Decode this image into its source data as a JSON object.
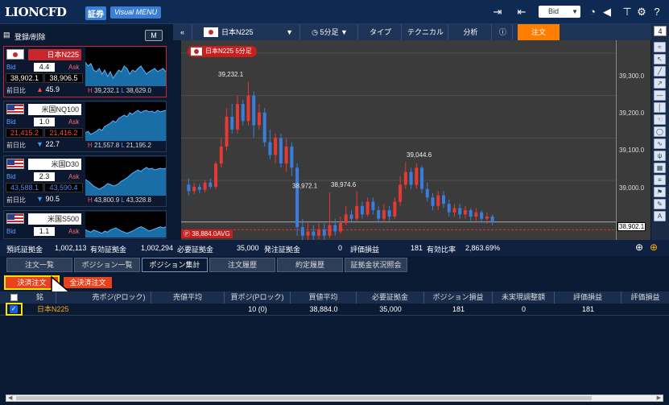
{
  "brand": {
    "logo": "LIONCFD",
    "badge": "証券",
    "menu_label": "Visual MENU"
  },
  "topbar": {
    "price_mode": "Bid"
  },
  "left": {
    "register_label": "登録/削除",
    "m_label": "M",
    "cards": [
      {
        "name": "日本N225",
        "flag": "jp",
        "spread": "4.4",
        "bid": "38,902.1",
        "ask": "38,906.5",
        "prev_label": "前日比",
        "dir": "up",
        "change": "45.9",
        "high": "39,232.1",
        "low": "38,629.0",
        "bid_color": "#ffffff",
        "ask_color": "#ffffff"
      },
      {
        "name": "米国NQ100",
        "flag": "us",
        "spread": "1.0",
        "bid": "21,415.2",
        "ask": "21,416.2",
        "prev_label": "前日比",
        "dir": "down",
        "change": "22.7",
        "high": "21,557.8",
        "low": "21,195.2",
        "bid_color": "#ff4545",
        "ask_color": "#ff4545"
      },
      {
        "name": "米国D30",
        "flag": "us",
        "spread": "2.3",
        "bid": "43,588.1",
        "ask": "43,590.4",
        "prev_label": "前日比",
        "dir": "down",
        "change": "90.5",
        "high": "43,800.9",
        "low": "43,328.8",
        "bid_color": "#4d8fff",
        "ask_color": "#4d8fff"
      },
      {
        "name": "米国S500",
        "flag": "us",
        "spread": "1.1"
      }
    ],
    "bid_label": "Bid",
    "ask_label": "Ask"
  },
  "toolbar": {
    "symbol": "日本N225",
    "interval": "5分足",
    "type": "タイプ",
    "technical": "テクニカル",
    "analysis": "分析",
    "order": "注文",
    "page": "4"
  },
  "chart": {
    "legend": "日本N225 5分足",
    "y_ticks": [
      "39,300.0",
      "39,200.0",
      "39,100.0",
      "39,000.0"
    ],
    "current_price": "38,902.1",
    "avg_label": "38,884.0AVG",
    "annotations": [
      "39,232.1",
      "38,972.1",
      "38,974.6",
      "39,044.6"
    ]
  },
  "chart_data": {
    "type": "candlestick",
    "title": "日本N225 5分足",
    "ylim": [
      38860,
      39330
    ],
    "labels": {
      "high": 39232.1,
      "peak2": 39044.6,
      "local1": 38972.1,
      "local2": 38974.6,
      "avg": 38884.0,
      "last": 38902.1
    },
    "series": [
      {
        "o": 38990,
        "c": 38975,
        "h": 39005,
        "l": 38965
      },
      {
        "o": 38975,
        "c": 38985,
        "h": 38995,
        "l": 38968
      },
      {
        "o": 38985,
        "c": 38978,
        "h": 38992,
        "l": 38970
      },
      {
        "o": 38978,
        "c": 38995,
        "h": 39000,
        "l": 38972
      },
      {
        "o": 38995,
        "c": 38985,
        "h": 39005,
        "l": 38980
      },
      {
        "o": 38985,
        "c": 39040,
        "h": 39045,
        "l": 38980
      },
      {
        "o": 39040,
        "c": 39080,
        "h": 39100,
        "l": 39030
      },
      {
        "o": 39080,
        "c": 39150,
        "h": 39170,
        "l": 39070
      },
      {
        "o": 39150,
        "c": 39120,
        "h": 39180,
        "l": 39110
      },
      {
        "o": 39120,
        "c": 39180,
        "h": 39200,
        "l": 39110
      },
      {
        "o": 39180,
        "c": 39140,
        "h": 39190,
        "l": 39130
      },
      {
        "o": 39140,
        "c": 39200,
        "h": 39232,
        "l": 39130
      },
      {
        "o": 39200,
        "c": 39130,
        "h": 39210,
        "l": 39100
      },
      {
        "o": 39130,
        "c": 39160,
        "h": 39180,
        "l": 39120
      },
      {
        "o": 39160,
        "c": 39090,
        "h": 39170,
        "l": 39080
      },
      {
        "o": 39090,
        "c": 39060,
        "h": 39120,
        "l": 39050
      },
      {
        "o": 39060,
        "c": 39100,
        "h": 39110,
        "l": 39040
      },
      {
        "o": 39100,
        "c": 39040,
        "h": 39110,
        "l": 39030
      },
      {
        "o": 39040,
        "c": 39080,
        "h": 39100,
        "l": 39020
      },
      {
        "o": 39080,
        "c": 39030,
        "h": 39090,
        "l": 39010
      },
      {
        "o": 39030,
        "c": 38890,
        "h": 39040,
        "l": 38870
      },
      {
        "o": 38890,
        "c": 38870,
        "h": 38910,
        "l": 38860
      },
      {
        "o": 38870,
        "c": 38880,
        "h": 38900,
        "l": 38860
      },
      {
        "o": 38880,
        "c": 38870,
        "h": 38895,
        "l": 38860
      },
      {
        "o": 38870,
        "c": 38885,
        "h": 38900,
        "l": 38862
      },
      {
        "o": 38885,
        "c": 38870,
        "h": 38900,
        "l": 38860
      },
      {
        "o": 38870,
        "c": 38895,
        "h": 38972,
        "l": 38865
      },
      {
        "o": 38895,
        "c": 38880,
        "h": 38910,
        "l": 38870
      },
      {
        "o": 38880,
        "c": 38900,
        "h": 38915,
        "l": 38875
      },
      {
        "o": 38900,
        "c": 38920,
        "h": 38940,
        "l": 38895
      },
      {
        "o": 38920,
        "c": 38910,
        "h": 38930,
        "l": 38900
      },
      {
        "o": 38910,
        "c": 38940,
        "h": 38975,
        "l": 38905
      },
      {
        "o": 38940,
        "c": 38920,
        "h": 38950,
        "l": 38910
      },
      {
        "o": 38920,
        "c": 38950,
        "h": 38960,
        "l": 38915
      },
      {
        "o": 38950,
        "c": 38930,
        "h": 38960,
        "l": 38920
      },
      {
        "o": 38930,
        "c": 38910,
        "h": 38940,
        "l": 38900
      },
      {
        "o": 38910,
        "c": 38930,
        "h": 38945,
        "l": 38900
      },
      {
        "o": 38930,
        "c": 38915,
        "h": 38940,
        "l": 38905
      },
      {
        "o": 38915,
        "c": 38950,
        "h": 38960,
        "l": 38910
      },
      {
        "o": 38950,
        "c": 38990,
        "h": 39010,
        "l": 38940
      },
      {
        "o": 38990,
        "c": 39020,
        "h": 39044,
        "l": 38980
      },
      {
        "o": 39020,
        "c": 38990,
        "h": 39030,
        "l": 38980
      },
      {
        "o": 38990,
        "c": 39030,
        "h": 39040,
        "l": 38980
      },
      {
        "o": 39030,
        "c": 38980,
        "h": 39035,
        "l": 38970
      },
      {
        "o": 38980,
        "c": 38960,
        "h": 38995,
        "l": 38950
      },
      {
        "o": 38960,
        "c": 38940,
        "h": 38970,
        "l": 38930
      },
      {
        "o": 38940,
        "c": 38965,
        "h": 38975,
        "l": 38930
      },
      {
        "o": 38965,
        "c": 38945,
        "h": 38975,
        "l": 38935
      },
      {
        "o": 38945,
        "c": 38925,
        "h": 38955,
        "l": 38915
      },
      {
        "o": 38925,
        "c": 38935,
        "h": 38945,
        "l": 38915
      },
      {
        "o": 38935,
        "c": 38920,
        "h": 38945,
        "l": 38910
      },
      {
        "o": 38920,
        "c": 38930,
        "h": 38940,
        "l": 38910
      },
      {
        "o": 38930,
        "c": 38915,
        "h": 38935,
        "l": 38905
      },
      {
        "o": 38915,
        "c": 38925,
        "h": 38935,
        "l": 38905
      },
      {
        "o": 38925,
        "c": 38910,
        "h": 38930,
        "l": 38900
      },
      {
        "o": 38910,
        "c": 38915,
        "h": 38925,
        "l": 38898
      },
      {
        "o": 38915,
        "c": 38902,
        "h": 38920,
        "l": 38895
      }
    ]
  },
  "status": {
    "deposit_label": "預託証拠金",
    "deposit": "1,002,113",
    "valid_label": "有効証拠金",
    "valid": "1,002,294",
    "required_label": "必要証拠金",
    "required": "35,000",
    "order_margin_label": "発注証拠金",
    "order_margin": "0",
    "eval_label": "評価損益",
    "eval": "181",
    "ratio_label": "有効比率",
    "ratio": "2,863.69%"
  },
  "tabs": [
    "注文一覧",
    "ポジション一覧",
    "ポジション集計",
    "注文履歴",
    "約定履歴",
    "証拠金状況照会"
  ],
  "actions": {
    "settle": "決済注文",
    "settle_all": "全決済注文"
  },
  "table": {
    "headers": [
      "銘",
      "売ポジ(Pロック)",
      "売値平均",
      "買ポジ(Pロック)",
      "買値平均",
      "必要証拠金",
      "ポジション損益",
      "未実現調整額",
      "評価損益",
      "評価損益"
    ],
    "row": {
      "symbol": "日本N225",
      "sell_pos": "",
      "sell_avg": "",
      "buy_pos": "10 (0)",
      "buy_avg": "38,884.0",
      "required": "35,000",
      "pos_pl": "181",
      "unrealized": "0",
      "eval": "181"
    }
  }
}
